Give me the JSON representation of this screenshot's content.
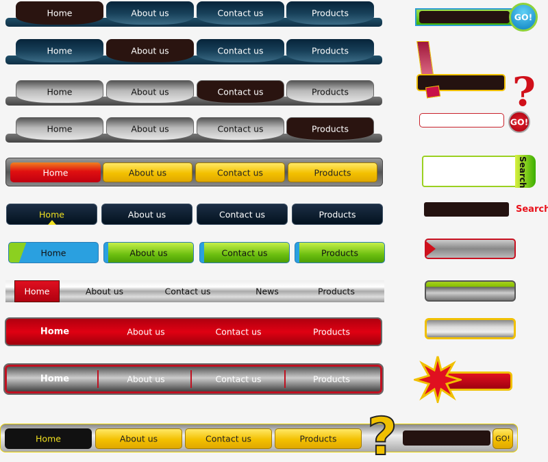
{
  "nav_bars": [
    {
      "style": "blue-tabs",
      "active": 0,
      "items": [
        "Home",
        "About us",
        "Contact us",
        "Products"
      ]
    },
    {
      "style": "blue-tabs",
      "active": 1,
      "items": [
        "Home",
        "About us",
        "Contact us",
        "Products"
      ]
    },
    {
      "style": "gray-tabs",
      "active": 2,
      "items": [
        "Home",
        "About us",
        "Contact us",
        "Products"
      ]
    },
    {
      "style": "gray-tabs",
      "active": 3,
      "items": [
        "Home",
        "About us",
        "Contact us",
        "Products"
      ]
    },
    {
      "style": "yellow-buttons",
      "active": 0,
      "items": [
        "Home",
        "About us",
        "Contact us",
        "Products"
      ]
    },
    {
      "style": "navy-buttons",
      "active": 0,
      "items": [
        "Home",
        "About us",
        "Contact us",
        "Products"
      ]
    },
    {
      "style": "green-blue-buttons",
      "active": 0,
      "items": [
        "Home",
        "About us",
        "Contact us",
        "Products"
      ]
    },
    {
      "style": "silver-bar",
      "active": 0,
      "items": [
        "Home",
        "About us",
        "Contact us",
        "News",
        "Products"
      ]
    },
    {
      "style": "red-bar",
      "active": 0,
      "items": [
        "Home",
        "About us",
        "Contact us",
        "Products"
      ]
    },
    {
      "style": "gray-red-bar",
      "active": 0,
      "items": [
        "Home",
        "About us",
        "Contact us",
        "Products"
      ]
    },
    {
      "style": "yellow-search-bar",
      "active": 0,
      "items": [
        "Home",
        "About us",
        "Contact us",
        "Products"
      ],
      "go_label": "GO!"
    }
  ],
  "widgets": {
    "go_blue_label": "GO!",
    "go_red_label": "GO!",
    "search_tab_label": "Search",
    "search_text_label": "Search"
  },
  "colors": {
    "navy": "#173f58",
    "active_tab": "#2a1410",
    "red": "#d0000f",
    "yellow": "#f3c000",
    "green": "#6cbf10"
  }
}
